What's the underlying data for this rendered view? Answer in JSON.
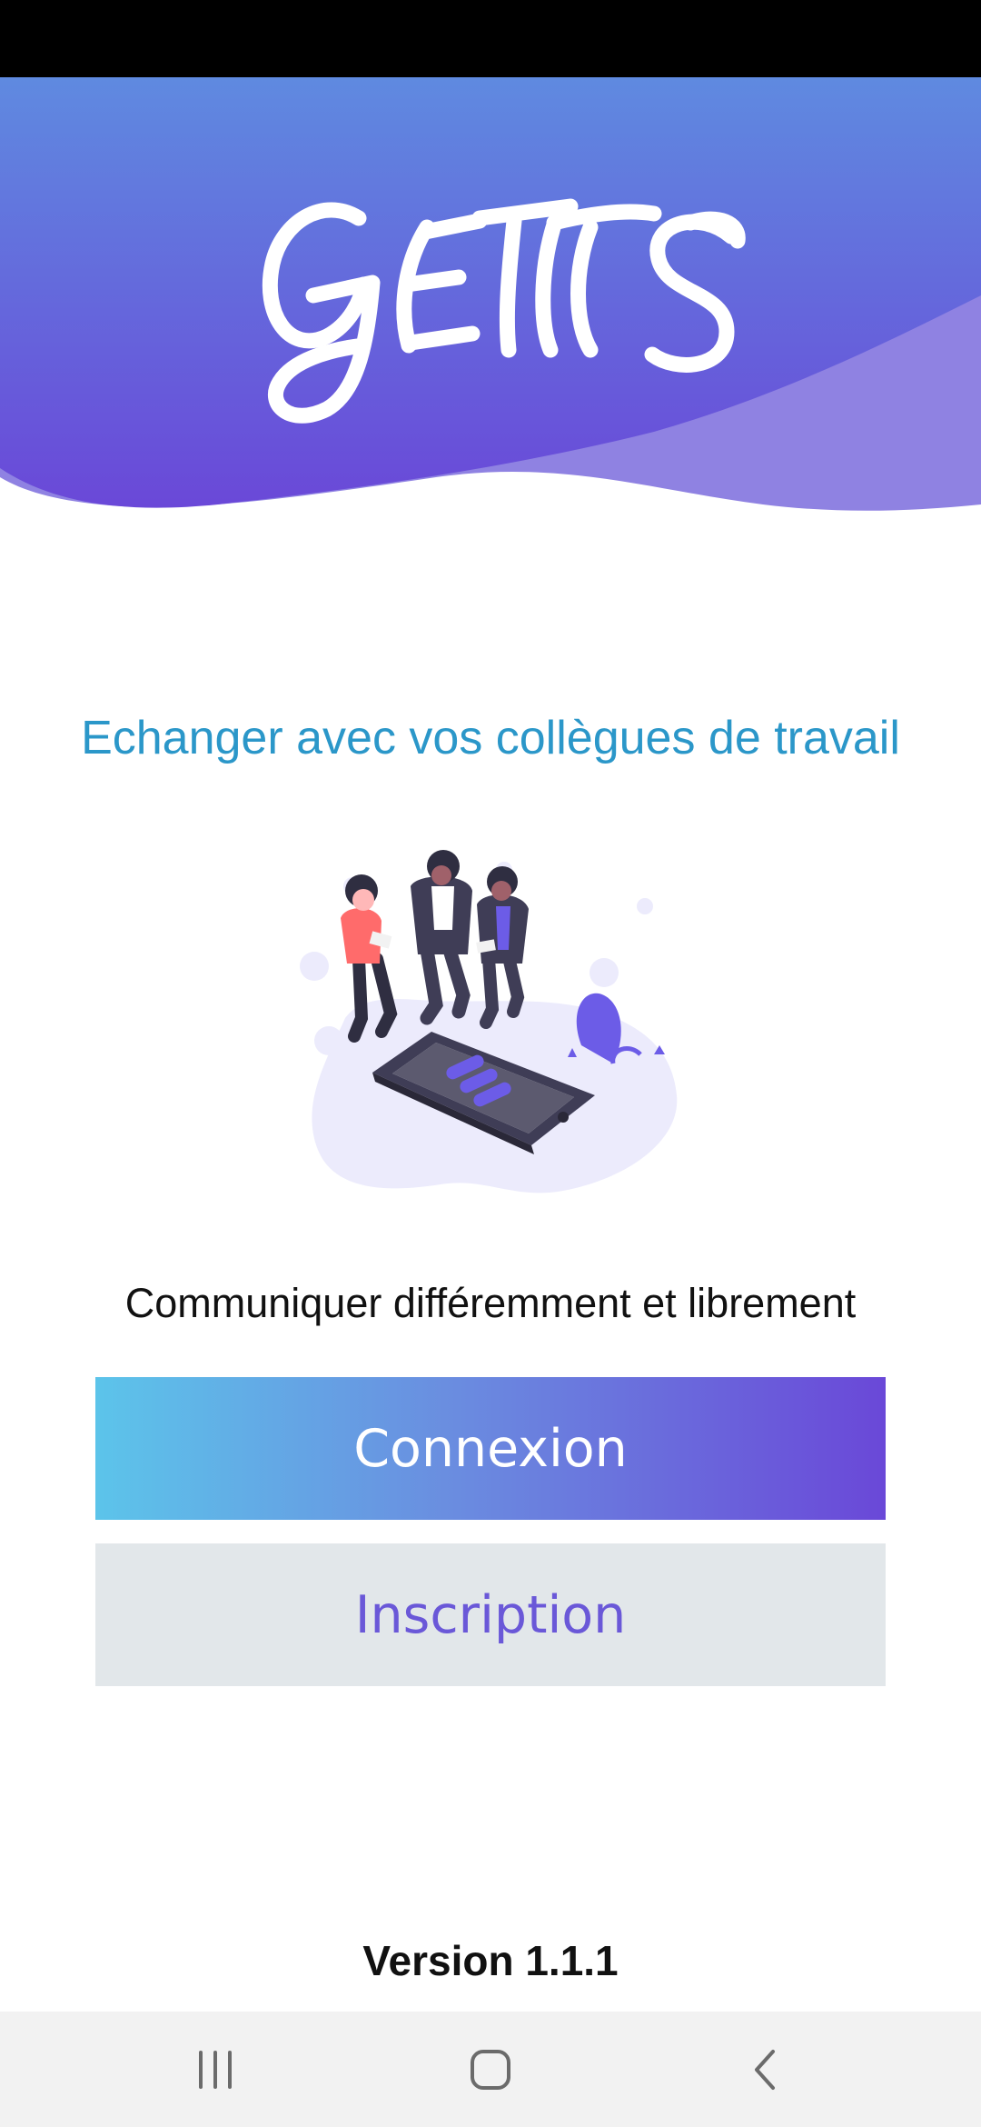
{
  "app": {
    "logo_text": "GETTS"
  },
  "hero": {
    "tagline": "Echanger avec vos collègues de travail",
    "illustration": "team-with-phone-illustration",
    "subtitle": "Communiquer différemment et librement"
  },
  "actions": {
    "login_label": "Connexion",
    "signup_label": "Inscription"
  },
  "footer": {
    "version": "Version 1.1.1"
  },
  "system_nav": {
    "recents_icon": "recents-icon",
    "home_icon": "home-icon",
    "back_icon": "back-icon"
  },
  "colors": {
    "header_top": "#5f8ae0",
    "header_bottom": "#6a48d8",
    "wave_light": "#8f82e2",
    "tagline": "#2b97c9",
    "login_gradient_start": "#5cc4ea",
    "login_gradient_end": "#6a48d8",
    "signup_bg": "#e2e7ea",
    "signup_text": "#6a58d8"
  }
}
